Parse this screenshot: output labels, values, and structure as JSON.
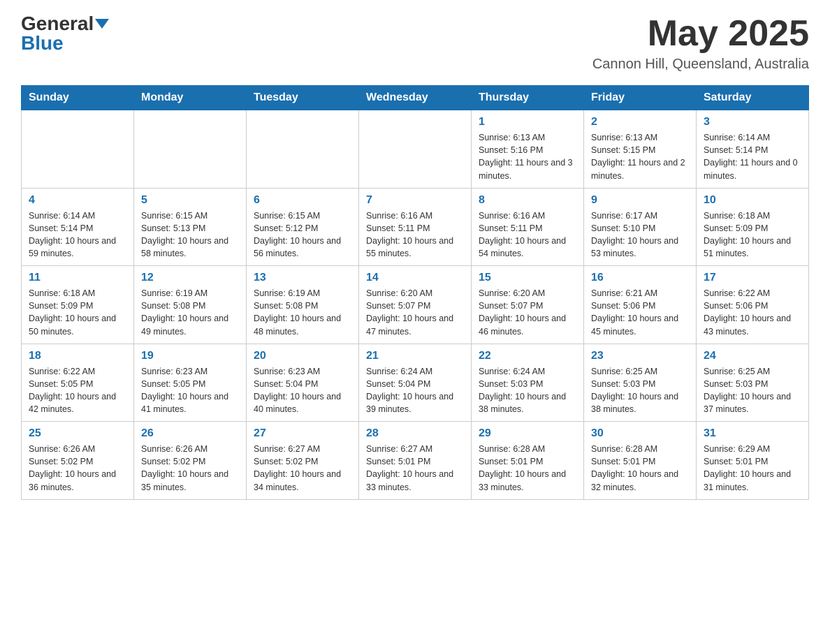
{
  "header": {
    "logo_general": "General",
    "logo_blue": "Blue",
    "month_title": "May 2025",
    "location": "Cannon Hill, Queensland, Australia"
  },
  "weekdays": [
    "Sunday",
    "Monday",
    "Tuesday",
    "Wednesday",
    "Thursday",
    "Friday",
    "Saturday"
  ],
  "weeks": [
    [
      {
        "day": "",
        "sunrise": "",
        "sunset": "",
        "daylight": ""
      },
      {
        "day": "",
        "sunrise": "",
        "sunset": "",
        "daylight": ""
      },
      {
        "day": "",
        "sunrise": "",
        "sunset": "",
        "daylight": ""
      },
      {
        "day": "",
        "sunrise": "",
        "sunset": "",
        "daylight": ""
      },
      {
        "day": "1",
        "sunrise": "Sunrise: 6:13 AM",
        "sunset": "Sunset: 5:16 PM",
        "daylight": "Daylight: 11 hours and 3 minutes."
      },
      {
        "day": "2",
        "sunrise": "Sunrise: 6:13 AM",
        "sunset": "Sunset: 5:15 PM",
        "daylight": "Daylight: 11 hours and 2 minutes."
      },
      {
        "day": "3",
        "sunrise": "Sunrise: 6:14 AM",
        "sunset": "Sunset: 5:14 PM",
        "daylight": "Daylight: 11 hours and 0 minutes."
      }
    ],
    [
      {
        "day": "4",
        "sunrise": "Sunrise: 6:14 AM",
        "sunset": "Sunset: 5:14 PM",
        "daylight": "Daylight: 10 hours and 59 minutes."
      },
      {
        "day": "5",
        "sunrise": "Sunrise: 6:15 AM",
        "sunset": "Sunset: 5:13 PM",
        "daylight": "Daylight: 10 hours and 58 minutes."
      },
      {
        "day": "6",
        "sunrise": "Sunrise: 6:15 AM",
        "sunset": "Sunset: 5:12 PM",
        "daylight": "Daylight: 10 hours and 56 minutes."
      },
      {
        "day": "7",
        "sunrise": "Sunrise: 6:16 AM",
        "sunset": "Sunset: 5:11 PM",
        "daylight": "Daylight: 10 hours and 55 minutes."
      },
      {
        "day": "8",
        "sunrise": "Sunrise: 6:16 AM",
        "sunset": "Sunset: 5:11 PM",
        "daylight": "Daylight: 10 hours and 54 minutes."
      },
      {
        "day": "9",
        "sunrise": "Sunrise: 6:17 AM",
        "sunset": "Sunset: 5:10 PM",
        "daylight": "Daylight: 10 hours and 53 minutes."
      },
      {
        "day": "10",
        "sunrise": "Sunrise: 6:18 AM",
        "sunset": "Sunset: 5:09 PM",
        "daylight": "Daylight: 10 hours and 51 minutes."
      }
    ],
    [
      {
        "day": "11",
        "sunrise": "Sunrise: 6:18 AM",
        "sunset": "Sunset: 5:09 PM",
        "daylight": "Daylight: 10 hours and 50 minutes."
      },
      {
        "day": "12",
        "sunrise": "Sunrise: 6:19 AM",
        "sunset": "Sunset: 5:08 PM",
        "daylight": "Daylight: 10 hours and 49 minutes."
      },
      {
        "day": "13",
        "sunrise": "Sunrise: 6:19 AM",
        "sunset": "Sunset: 5:08 PM",
        "daylight": "Daylight: 10 hours and 48 minutes."
      },
      {
        "day": "14",
        "sunrise": "Sunrise: 6:20 AM",
        "sunset": "Sunset: 5:07 PM",
        "daylight": "Daylight: 10 hours and 47 minutes."
      },
      {
        "day": "15",
        "sunrise": "Sunrise: 6:20 AM",
        "sunset": "Sunset: 5:07 PM",
        "daylight": "Daylight: 10 hours and 46 minutes."
      },
      {
        "day": "16",
        "sunrise": "Sunrise: 6:21 AM",
        "sunset": "Sunset: 5:06 PM",
        "daylight": "Daylight: 10 hours and 45 minutes."
      },
      {
        "day": "17",
        "sunrise": "Sunrise: 6:22 AM",
        "sunset": "Sunset: 5:06 PM",
        "daylight": "Daylight: 10 hours and 43 minutes."
      }
    ],
    [
      {
        "day": "18",
        "sunrise": "Sunrise: 6:22 AM",
        "sunset": "Sunset: 5:05 PM",
        "daylight": "Daylight: 10 hours and 42 minutes."
      },
      {
        "day": "19",
        "sunrise": "Sunrise: 6:23 AM",
        "sunset": "Sunset: 5:05 PM",
        "daylight": "Daylight: 10 hours and 41 minutes."
      },
      {
        "day": "20",
        "sunrise": "Sunrise: 6:23 AM",
        "sunset": "Sunset: 5:04 PM",
        "daylight": "Daylight: 10 hours and 40 minutes."
      },
      {
        "day": "21",
        "sunrise": "Sunrise: 6:24 AM",
        "sunset": "Sunset: 5:04 PM",
        "daylight": "Daylight: 10 hours and 39 minutes."
      },
      {
        "day": "22",
        "sunrise": "Sunrise: 6:24 AM",
        "sunset": "Sunset: 5:03 PM",
        "daylight": "Daylight: 10 hours and 38 minutes."
      },
      {
        "day": "23",
        "sunrise": "Sunrise: 6:25 AM",
        "sunset": "Sunset: 5:03 PM",
        "daylight": "Daylight: 10 hours and 38 minutes."
      },
      {
        "day": "24",
        "sunrise": "Sunrise: 6:25 AM",
        "sunset": "Sunset: 5:03 PM",
        "daylight": "Daylight: 10 hours and 37 minutes."
      }
    ],
    [
      {
        "day": "25",
        "sunrise": "Sunrise: 6:26 AM",
        "sunset": "Sunset: 5:02 PM",
        "daylight": "Daylight: 10 hours and 36 minutes."
      },
      {
        "day": "26",
        "sunrise": "Sunrise: 6:26 AM",
        "sunset": "Sunset: 5:02 PM",
        "daylight": "Daylight: 10 hours and 35 minutes."
      },
      {
        "day": "27",
        "sunrise": "Sunrise: 6:27 AM",
        "sunset": "Sunset: 5:02 PM",
        "daylight": "Daylight: 10 hours and 34 minutes."
      },
      {
        "day": "28",
        "sunrise": "Sunrise: 6:27 AM",
        "sunset": "Sunset: 5:01 PM",
        "daylight": "Daylight: 10 hours and 33 minutes."
      },
      {
        "day": "29",
        "sunrise": "Sunrise: 6:28 AM",
        "sunset": "Sunset: 5:01 PM",
        "daylight": "Daylight: 10 hours and 33 minutes."
      },
      {
        "day": "30",
        "sunrise": "Sunrise: 6:28 AM",
        "sunset": "Sunset: 5:01 PM",
        "daylight": "Daylight: 10 hours and 32 minutes."
      },
      {
        "day": "31",
        "sunrise": "Sunrise: 6:29 AM",
        "sunset": "Sunset: 5:01 PM",
        "daylight": "Daylight: 10 hours and 31 minutes."
      }
    ]
  ]
}
